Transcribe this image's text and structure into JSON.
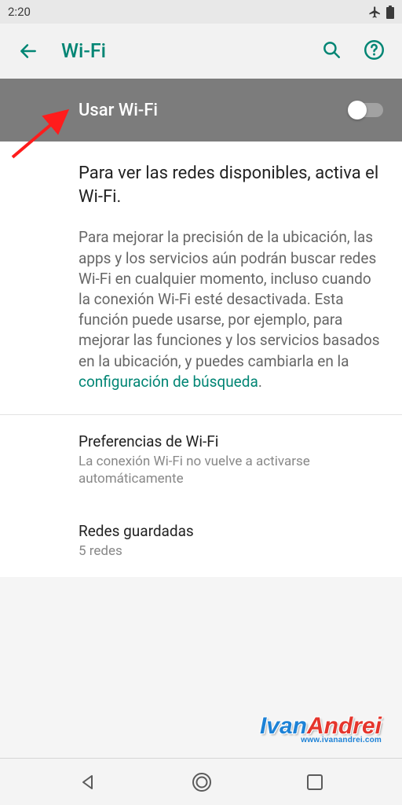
{
  "status": {
    "time": "2:20"
  },
  "header": {
    "title": "Wi-Fi"
  },
  "toggle": {
    "label": "Usar Wi-Fi",
    "enabled": false
  },
  "info": {
    "title": "Para ver las redes disponibles, activa el Wi-Fi.",
    "body_prefix": "Para mejorar la precisión de la ubicación, las apps y los servicios aún podrán buscar redes Wi-Fi en cualquier momento, incluso cuando la conexión Wi-Fi esté desactivada. Esta función puede usarse, por ejemplo, para mejorar las funciones y los servicios basados en la ubicación, y puedes cambiarla en la ",
    "link_text": "configuración de búsqueda",
    "body_suffix": "."
  },
  "items": [
    {
      "title": "Preferencias de Wi-Fi",
      "subtitle": "La conexión Wi-Fi no vuelve a activarse automáticamente"
    },
    {
      "title": "Redes guardadas",
      "subtitle": "5 redes"
    }
  ],
  "watermark": {
    "part1": "Ivan",
    "part2": "Andrei",
    "url": "www.ivanandrei.com"
  },
  "colors": {
    "accent": "#018574",
    "toggle_panel": "#7c7c7c",
    "annotation_arrow": "#ff1c1c"
  }
}
